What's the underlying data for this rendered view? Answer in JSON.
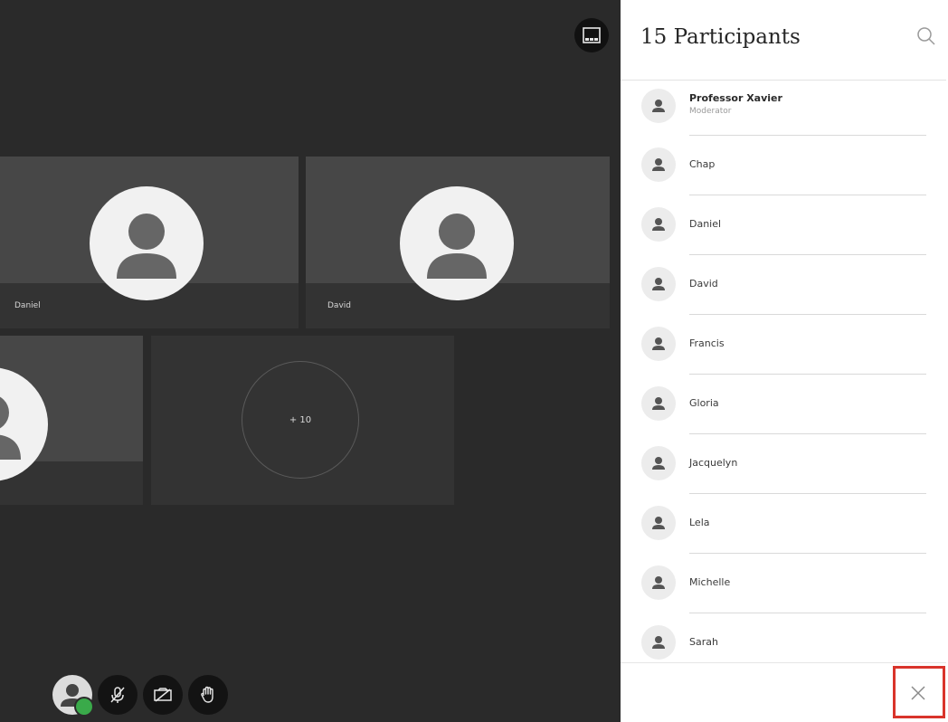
{
  "panel": {
    "title": "15 Participants",
    "search_icon": "search-icon",
    "close_icon": "close-icon",
    "participants": [
      {
        "name": "Professor Xavier",
        "role": "Moderator"
      },
      {
        "name": "Chap"
      },
      {
        "name": "Daniel"
      },
      {
        "name": "David"
      },
      {
        "name": "Francis"
      },
      {
        "name": "Gloria"
      },
      {
        "name": "Jacquelyn"
      },
      {
        "name": "Lela"
      },
      {
        "name": "Michelle"
      },
      {
        "name": "Sarah"
      }
    ]
  },
  "stage": {
    "tiles": [
      {
        "name": "Daniel"
      },
      {
        "name": "David"
      }
    ],
    "overflow_label": "+ 10",
    "layout_icon": "gallery-layout-icon"
  },
  "controls": {
    "avatar_icon": "user-avatar-icon",
    "mic_icon": "mic-muted-icon",
    "camera_icon": "camera-off-icon",
    "hand_icon": "raise-hand-icon"
  },
  "colors": {
    "stage_bg": "#2a2a2a",
    "status_green": "#3aaa4a",
    "highlight_red": "#d9342b"
  }
}
